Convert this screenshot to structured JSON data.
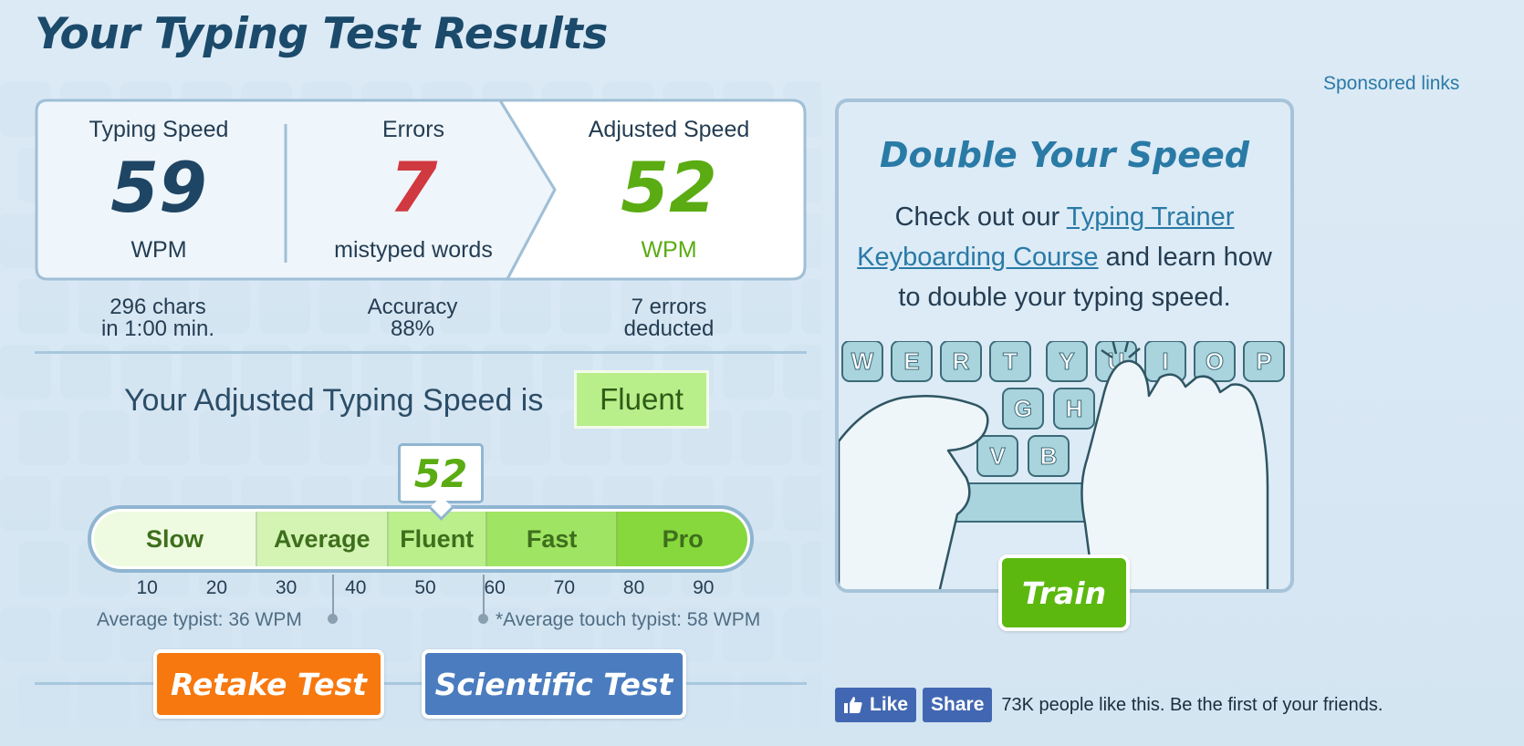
{
  "page": {
    "title": "Your Typing Test Results",
    "sponsored_label": "Sponsored links"
  },
  "results": {
    "typing_speed": {
      "label": "Typing Speed",
      "value": "59",
      "unit": "WPM",
      "detail_line1": "296 chars",
      "detail_line2": "in 1:00 min."
    },
    "errors": {
      "label": "Errors",
      "value": "7",
      "unit": "mistyped words",
      "detail_line1": "Accuracy",
      "detail_line2": "88%"
    },
    "adjusted_speed": {
      "label": "Adjusted Speed",
      "value": "52",
      "unit": "WPM",
      "detail_line1": "7 errors",
      "detail_line2": "deducted"
    }
  },
  "level": {
    "prefix": "Your Adjusted Typing Speed is",
    "value": "Fluent"
  },
  "scale": {
    "marker_value": "52",
    "segments": [
      {
        "label": "Slow",
        "color": "#eefbe0",
        "from": 0,
        "to": 25
      },
      {
        "label": "Average",
        "color": "#d3f4b3",
        "from": 25,
        "to": 45
      },
      {
        "label": "Fluent",
        "color": "#baef8c",
        "from": 45,
        "to": 60
      },
      {
        "label": "Fast",
        "color": "#9fe463",
        "from": 60,
        "to": 80
      },
      {
        "label": "Pro",
        "color": "#86d83c",
        "from": 80,
        "to": 100
      }
    ],
    "ticks": [
      "10",
      "20",
      "30",
      "40",
      "50",
      "60",
      "70",
      "80",
      "90"
    ],
    "average_typist": {
      "label": "Average typist: 36 WPM",
      "wpm": 36
    },
    "average_touch_typist": {
      "label": "*Average touch typist: 58 WPM",
      "wpm": 58
    }
  },
  "buttons": {
    "retake": "Retake Test",
    "scientific": "Scientific Test",
    "train": "Train"
  },
  "promo": {
    "title": "Double Your Speed",
    "text_before": "Check out our ",
    "link": "Typing Trainer Keyboarding Course",
    "text_after": " and learn how to double your typing speed.",
    "keys_row1": [
      "W",
      "E",
      "R",
      "T",
      "Y",
      "U",
      "I",
      "O",
      "P"
    ],
    "keys_row2": [
      "G",
      "H"
    ],
    "keys_row3": [
      "V",
      "B"
    ]
  },
  "facebook": {
    "like": "Like",
    "share": "Share",
    "text": "73K people like this. Be the first of your friends."
  },
  "colors": {
    "title": "#1b4a6b",
    "errors": "#d0393f",
    "adjusted": "#5aac12",
    "accent": "#2a7aa6"
  }
}
